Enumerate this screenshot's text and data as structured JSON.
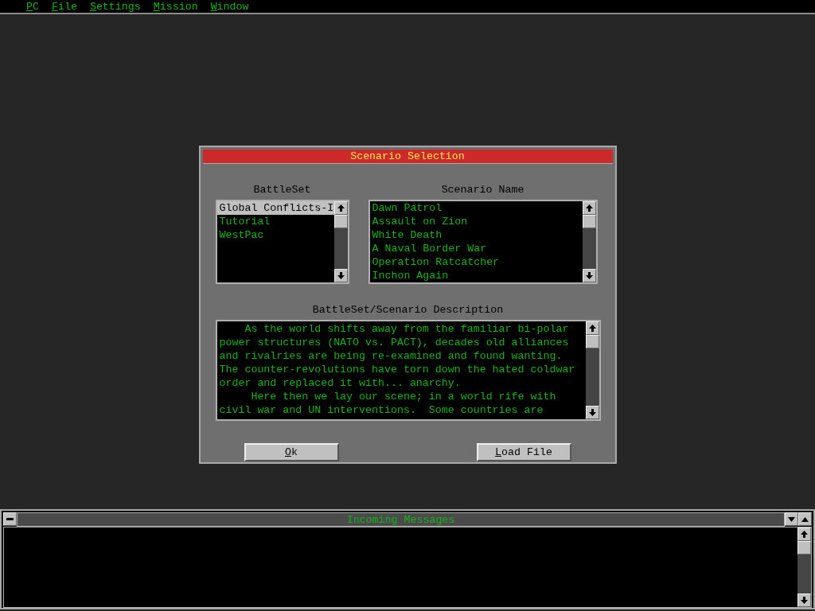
{
  "menu": [
    {
      "label": "PC",
      "underlined_first_letter": true
    },
    {
      "label": "File",
      "underlined_first_letter": true
    },
    {
      "label": "Settings",
      "underlined_first_letter": true
    },
    {
      "label": "Mission",
      "underlined_first_letter": true
    },
    {
      "label": "Window",
      "underlined_first_letter": true
    }
  ],
  "dialog": {
    "title": "Scenario Selection",
    "battleset": {
      "label": "BattleSet",
      "items": [
        {
          "label": "Global Conflicts-I",
          "selected": true
        },
        {
          "label": "Tutorial",
          "selected": false
        },
        {
          "label": "WestPac",
          "selected": false
        }
      ]
    },
    "scenario": {
      "label": "Scenario Name",
      "items": [
        {
          "label": "Dawn Patrol",
          "selected": false
        },
        {
          "label": "Assault on Zion",
          "selected": false
        },
        {
          "label": "White Death",
          "selected": false
        },
        {
          "label": "A Naval Border War",
          "selected": false
        },
        {
          "label": "Operation Ratcatcher",
          "selected": false
        },
        {
          "label": "Inchon Again",
          "selected": false
        }
      ]
    },
    "description": {
      "label": "BattleSet/Scenario Description",
      "text": "    As the world shifts away from the familiar bi-polar\npower structures (NATO vs. PACT), decades old alliances\nand rivalries are being re-examined and found wanting.\nThe counter-revolutions have torn down the hated coldwar\norder and replaced it with... anarchy.\n     Here then we lay our scene; in a world rife with\ncivil war and UN interventions.  Some countries are"
    },
    "buttons": [
      {
        "label": "Ok",
        "underlined_first_letter": true
      },
      {
        "label": "Load File",
        "underlined_first_letter": true
      }
    ]
  },
  "messages": {
    "title": "Incoming Messages"
  }
}
